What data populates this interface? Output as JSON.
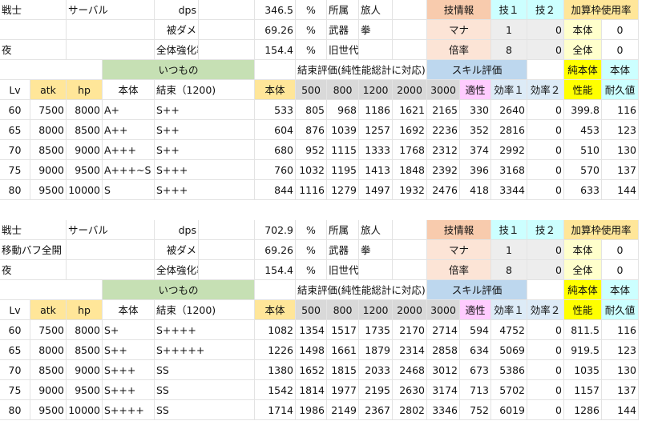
{
  "tables": [
    {
      "info_rows": [
        {
          "a": "戦士",
          "b": "サーバル",
          "label": "dps",
          "value": "346.5",
          "unit": "%",
          "k1": "所属",
          "v1": "旅人",
          "skill_head": "技情報",
          "t1": "技１",
          "t2": "技２",
          "extra_head": "加算枠使用率"
        },
        {
          "a": "",
          "b": "",
          "label": "被ダメ",
          "value": "69.26",
          "unit": "%",
          "k1": "武器",
          "v1": "拳",
          "skill_head": "マナ",
          "t1": "1",
          "t2": "0",
          "extra_head": "本体",
          "extra_val": "0"
        },
        {
          "a": "夜",
          "b": "",
          "label": "全体強化率",
          "value": "154.4",
          "unit": "%",
          "k1": "旧世代",
          "v1": "",
          "skill_head": "倍率",
          "t1": "8",
          "t2": "0",
          "extra_head": "全体",
          "extra_val": "0"
        }
      ],
      "group_header": {
        "itsumono": "いつもの",
        "kessoku": "結束評価(純性能総計に対応)",
        "skill": "スキル評価",
        "junhontai": "純本体",
        "hontai": "本体"
      },
      "col_header": {
        "lv": "Lv",
        "atk": "atk",
        "hp": "hp",
        "body": "本体",
        "bond": "結束（1200)",
        "base": "本体",
        "k500": "500",
        "k800": "800",
        "k1200": "1200",
        "k2000": "2000",
        "k3000": "3000",
        "aptitude": "適性",
        "eff1": "効率１",
        "eff2": "効率２",
        "perf": "性能",
        "dur": "耐久値"
      },
      "rows": [
        {
          "lv": "60",
          "atk": "7500",
          "hp": "8000",
          "body": "A+",
          "bond": "S++",
          "base": "533",
          "k500": "805",
          "k800": "968",
          "k1200": "1186",
          "k2000": "1621",
          "k3000": "2165",
          "aptitude": "330",
          "eff1": "2640",
          "eff2": "0",
          "perf": "399.8",
          "dur": "116"
        },
        {
          "lv": "65",
          "atk": "8000",
          "hp": "8500",
          "body": "A++",
          "bond": "S++",
          "base": "604",
          "k500": "876",
          "k800": "1039",
          "k1200": "1257",
          "k2000": "1692",
          "k3000": "2236",
          "aptitude": "352",
          "eff1": "2816",
          "eff2": "0",
          "perf": "453",
          "dur": "123"
        },
        {
          "lv": "70",
          "atk": "8500",
          "hp": "9000",
          "body": "A+++",
          "bond": "S++",
          "base": "680",
          "k500": "952",
          "k800": "1115",
          "k1200": "1333",
          "k2000": "1768",
          "k3000": "2312",
          "aptitude": "374",
          "eff1": "2992",
          "eff2": "0",
          "perf": "510",
          "dur": "130"
        },
        {
          "lv": "75",
          "atk": "9000",
          "hp": "9500",
          "body": "A+++~S",
          "bond": "S+++",
          "base": "760",
          "k500": "1032",
          "k800": "1195",
          "k1200": "1413",
          "k2000": "1848",
          "k3000": "2392",
          "aptitude": "396",
          "eff1": "3168",
          "eff2": "0",
          "perf": "570",
          "dur": "137"
        },
        {
          "lv": "80",
          "atk": "9500",
          "hp": "10000",
          "body": "S",
          "bond": "S+++",
          "base": "844",
          "k500": "1116",
          "k800": "1279",
          "k1200": "1497",
          "k2000": "1932",
          "k3000": "2476",
          "aptitude": "418",
          "eff1": "3344",
          "eff2": "0",
          "perf": "633",
          "dur": "144"
        }
      ]
    },
    {
      "info_rows": [
        {
          "a": "戦士",
          "b": "サーバル",
          "label": "dps",
          "value": "702.9",
          "unit": "%",
          "k1": "所属",
          "v1": "旅人",
          "skill_head": "技情報",
          "t1": "技１",
          "t2": "技２",
          "extra_head": "加算枠使用率"
        },
        {
          "a": "移動バフ全開",
          "b": "",
          "label": "被ダメ",
          "value": "69.26",
          "unit": "%",
          "k1": "武器",
          "v1": "拳",
          "skill_head": "マナ",
          "t1": "1",
          "t2": "0",
          "extra_head": "本体",
          "extra_val": "0"
        },
        {
          "a": "夜",
          "b": "",
          "label": "全体強化率",
          "value": "154.4",
          "unit": "%",
          "k1": "旧世代",
          "v1": "",
          "skill_head": "倍率",
          "t1": "8",
          "t2": "0",
          "extra_head": "全体",
          "extra_val": "0"
        }
      ],
      "group_header": {
        "itsumono": "いつもの",
        "kessoku": "結束評価(純性能総計に対応)",
        "skill": "スキル評価",
        "junhontai": "純本体",
        "hontai": "本体"
      },
      "col_header": {
        "lv": "Lv",
        "atk": "atk",
        "hp": "hp",
        "body": "本体",
        "bond": "結束（1200)",
        "base": "本体",
        "k500": "500",
        "k800": "800",
        "k1200": "1200",
        "k2000": "2000",
        "k3000": "3000",
        "aptitude": "適性",
        "eff1": "効率１",
        "eff2": "効率２",
        "perf": "性能",
        "dur": "耐久値"
      },
      "rows": [
        {
          "lv": "60",
          "atk": "7500",
          "hp": "8000",
          "body": "S+",
          "bond": "S++++",
          "base": "1082",
          "k500": "1354",
          "k800": "1517",
          "k1200": "1735",
          "k2000": "2170",
          "k3000": "2714",
          "aptitude": "594",
          "eff1": "4752",
          "eff2": "0",
          "perf": "811.5",
          "dur": "116"
        },
        {
          "lv": "65",
          "atk": "8000",
          "hp": "8500",
          "body": "S++",
          "bond": "S+++++",
          "base": "1226",
          "k500": "1498",
          "k800": "1661",
          "k1200": "1879",
          "k2000": "2314",
          "k3000": "2858",
          "aptitude": "634",
          "eff1": "5069",
          "eff2": "0",
          "perf": "919.5",
          "dur": "123"
        },
        {
          "lv": "70",
          "atk": "8500",
          "hp": "9000",
          "body": "S+++",
          "bond": "SS",
          "base": "1380",
          "k500": "1652",
          "k800": "1815",
          "k1200": "2033",
          "k2000": "2468",
          "k3000": "3012",
          "aptitude": "673",
          "eff1": "5386",
          "eff2": "0",
          "perf": "1035",
          "dur": "130"
        },
        {
          "lv": "75",
          "atk": "9000",
          "hp": "9500",
          "body": "S+++",
          "bond": "SS",
          "base": "1542",
          "k500": "1814",
          "k800": "1977",
          "k1200": "2195",
          "k2000": "2630",
          "k3000": "3174",
          "aptitude": "713",
          "eff1": "5702",
          "eff2": "0",
          "perf": "1157",
          "dur": "137"
        },
        {
          "lv": "80",
          "atk": "9500",
          "hp": "10000",
          "body": "S++++",
          "bond": "SS",
          "base": "1714",
          "k500": "1986",
          "k800": "2149",
          "k1200": "2367",
          "k2000": "2802",
          "k3000": "3346",
          "aptitude": "752",
          "eff1": "6019",
          "eff2": "0",
          "perf": "1286",
          "dur": "144"
        }
      ]
    }
  ]
}
